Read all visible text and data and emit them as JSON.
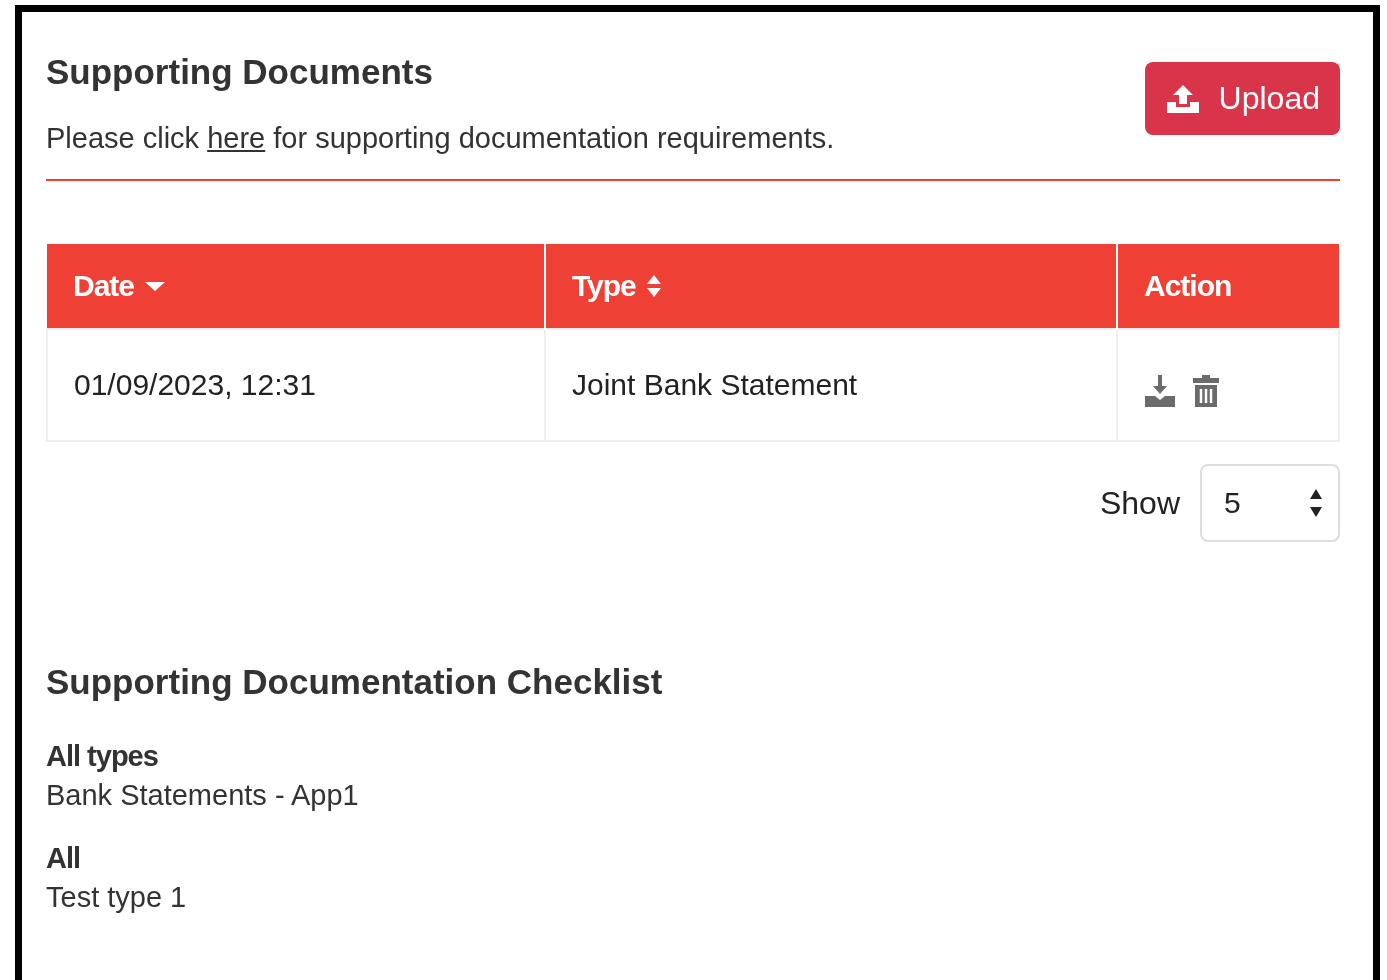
{
  "title": "Supporting Documents",
  "upload_button": {
    "label": "Upload"
  },
  "intro": {
    "before": "Please click ",
    "link": "here",
    "after": " for supporting documentation requirements."
  },
  "table": {
    "columns": [
      {
        "label": "Date",
        "kind": "sorted"
      },
      {
        "label": "Type",
        "kind": "sortable"
      },
      {
        "label": "Action",
        "kind": "plain"
      }
    ],
    "rows": [
      {
        "cells": [
          "01/09/2023, 12:31",
          "Joint Bank Statement"
        ],
        "actions": [
          {
            "kind": "download"
          },
          {
            "kind": "delete"
          }
        ]
      }
    ]
  },
  "page_size": {
    "label": "Show",
    "value": "5"
  },
  "checklist": {
    "title": "Supporting Documentation Checklist",
    "groups": [
      {
        "heading": "All types",
        "items": [
          "Bank Statements - App1"
        ]
      },
      {
        "heading": "All",
        "items": [
          "Test type 1"
        ]
      }
    ]
  }
}
